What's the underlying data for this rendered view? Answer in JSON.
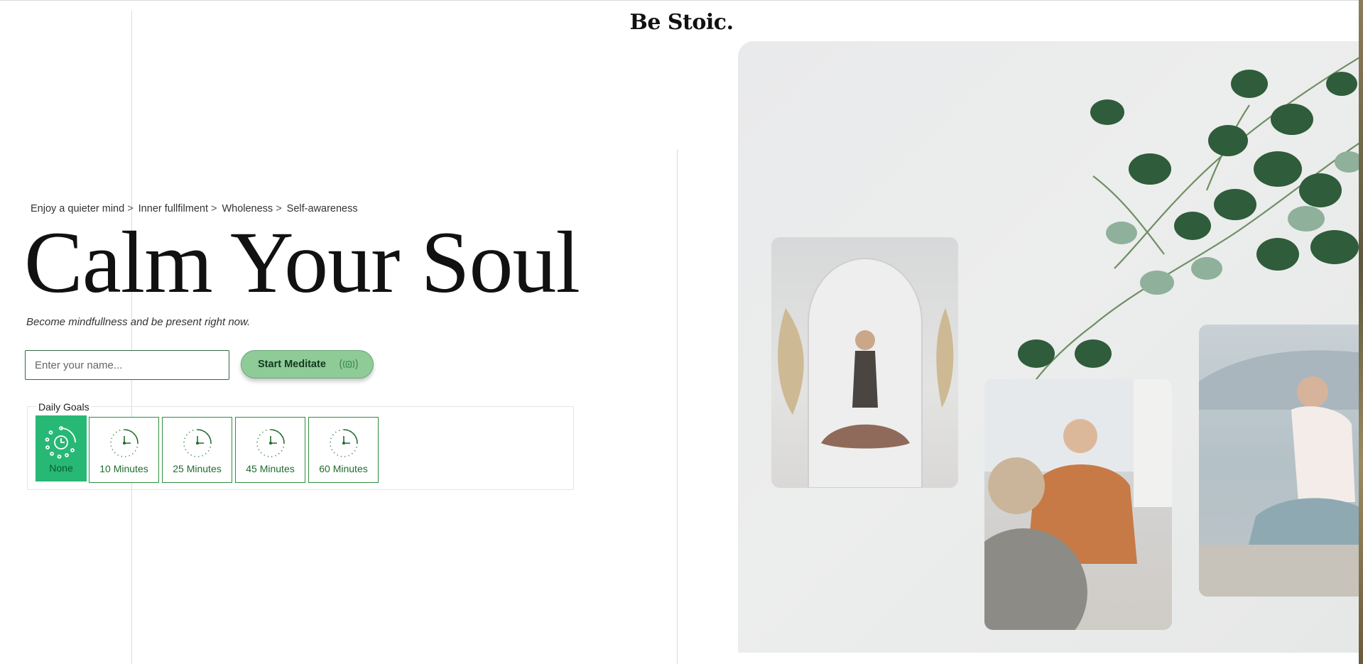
{
  "brand": "Be Stoic.",
  "breadcrumbs": [
    {
      "label": "Enjoy a quieter mind",
      "sep": ">"
    },
    {
      "label": "Inner fullfilment",
      "sep": ">"
    },
    {
      "label": "Wholeness",
      "sep": ">"
    },
    {
      "label": "Self-awareness",
      "sep": ""
    }
  ],
  "hero": {
    "title": "Calm Your Soul",
    "subtitle": "Become mindfullness and be present right now."
  },
  "form": {
    "name_placeholder": "Enter your name...",
    "start_label": "Start Meditate"
  },
  "goals": {
    "legend": "Daily Goals",
    "options": [
      "None",
      "10 Minutes",
      "25 Minutes",
      "45 Minutes",
      "60 Minutes"
    ],
    "selected": "None"
  },
  "colors": {
    "accent_green": "#27b876",
    "border_green": "#2f8f3f",
    "button_green": "#8ecb97"
  }
}
